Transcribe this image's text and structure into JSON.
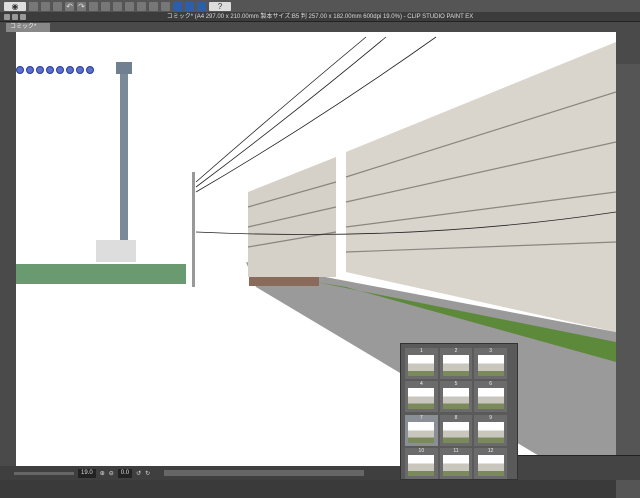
{
  "window": {
    "title": "コミック* (A4 297.00 x 210.00mm 製本サイズ:B5 判 257.00 x 182.00mm 600dpi 19.0%) - CLIP STUDIO PAINT EX"
  },
  "tab": {
    "label": "コミック*"
  },
  "status": {
    "zoom": "19.0",
    "rotation": "0.0"
  },
  "thumbnails": [
    {
      "n": "1"
    },
    {
      "n": "2"
    },
    {
      "n": "3"
    },
    {
      "n": "4"
    },
    {
      "n": "5"
    },
    {
      "n": "6"
    },
    {
      "n": "7",
      "selected": true
    },
    {
      "n": "8"
    },
    {
      "n": "9"
    },
    {
      "n": "10"
    },
    {
      "n": "11"
    },
    {
      "n": "12"
    }
  ]
}
